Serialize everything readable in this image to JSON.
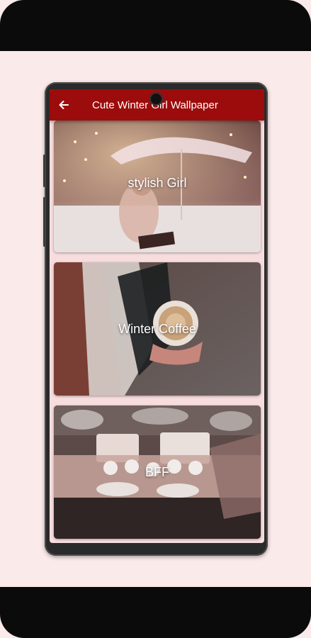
{
  "app_bar": {
    "title": "Cute Winter Girl Wallpaper",
    "back_icon": "arrow-left-icon",
    "background": "#9c0c0c"
  },
  "categories": [
    {
      "label": "stylish Girl"
    },
    {
      "label": "Winter Coffee"
    },
    {
      "label": "BFF"
    }
  ],
  "colors": {
    "page_background": "#fbeaea",
    "device_frame": "#0b0b0b"
  }
}
